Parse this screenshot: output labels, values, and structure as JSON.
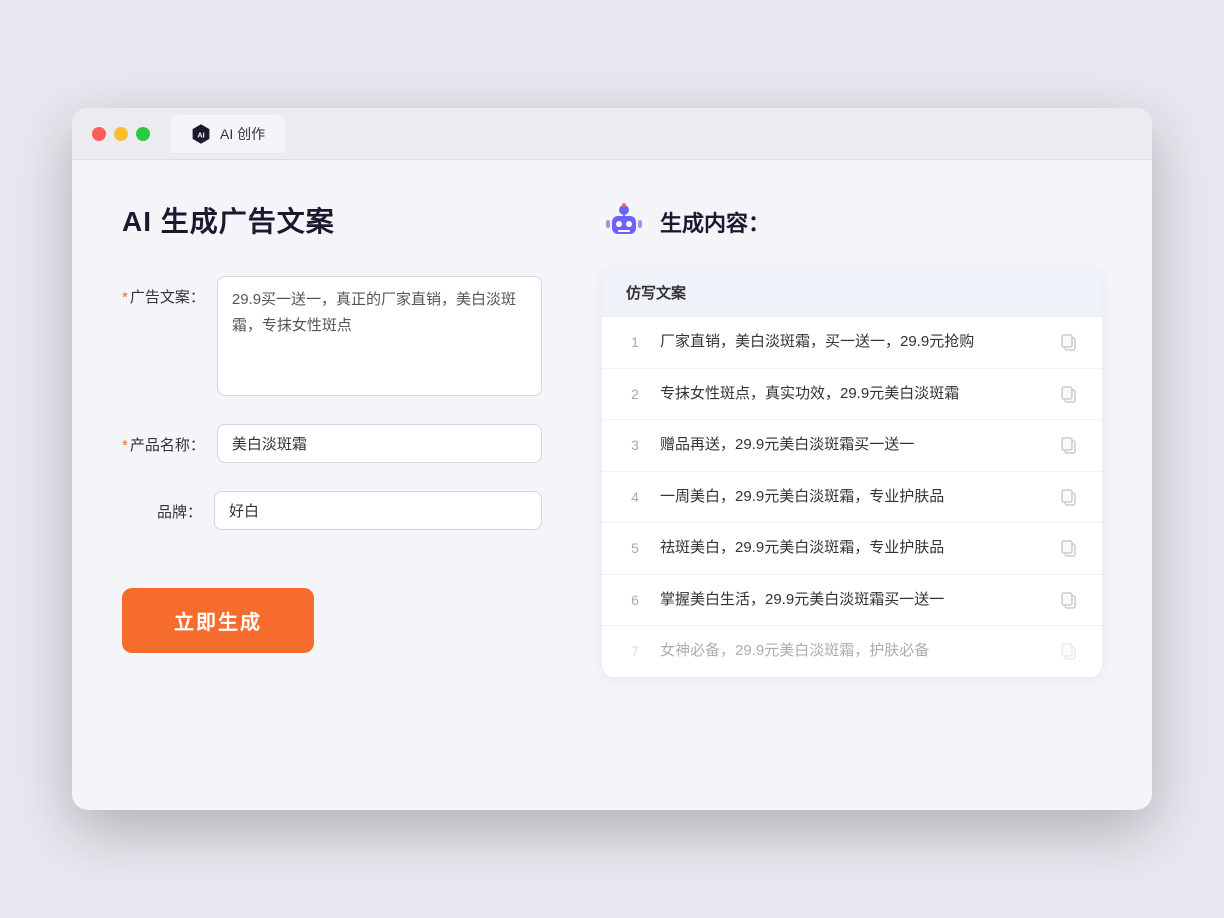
{
  "browser": {
    "tab_label": "AI 创作"
  },
  "left": {
    "title": "AI 生成广告文案",
    "fields": [
      {
        "id": "ad-copy",
        "label": "广告文案：",
        "required": true,
        "type": "textarea",
        "value": "29.9买一送一，真正的厂家直销，美白淡斑霜，专抹女性斑点"
      },
      {
        "id": "product-name",
        "label": "产品名称：",
        "required": true,
        "type": "input",
        "value": "美白淡斑霜"
      },
      {
        "id": "brand",
        "label": "品牌：",
        "required": false,
        "type": "input",
        "value": "好白"
      }
    ],
    "generate_button": "立即生成"
  },
  "right": {
    "title": "生成内容：",
    "column_header": "仿写文案",
    "results": [
      {
        "num": "1",
        "text": "厂家直销，美白淡斑霜，买一送一，29.9元抢购",
        "faded": false
      },
      {
        "num": "2",
        "text": "专抹女性斑点，真实功效，29.9元美白淡斑霜",
        "faded": false
      },
      {
        "num": "3",
        "text": "赠品再送，29.9元美白淡斑霜买一送一",
        "faded": false
      },
      {
        "num": "4",
        "text": "一周美白，29.9元美白淡斑霜，专业护肤品",
        "faded": false
      },
      {
        "num": "5",
        "text": "祛斑美白，29.9元美白淡斑霜，专业护肤品",
        "faded": false
      },
      {
        "num": "6",
        "text": "掌握美白生活，29.9元美白淡斑霜买一送一",
        "faded": false
      },
      {
        "num": "7",
        "text": "女神必备，29.9元美白淡斑霜，护肤必备",
        "faded": true
      }
    ]
  },
  "colors": {
    "accent": "#f56c2d",
    "tab_bg": "#f4f5f9",
    "border": "#d0d5e8"
  }
}
